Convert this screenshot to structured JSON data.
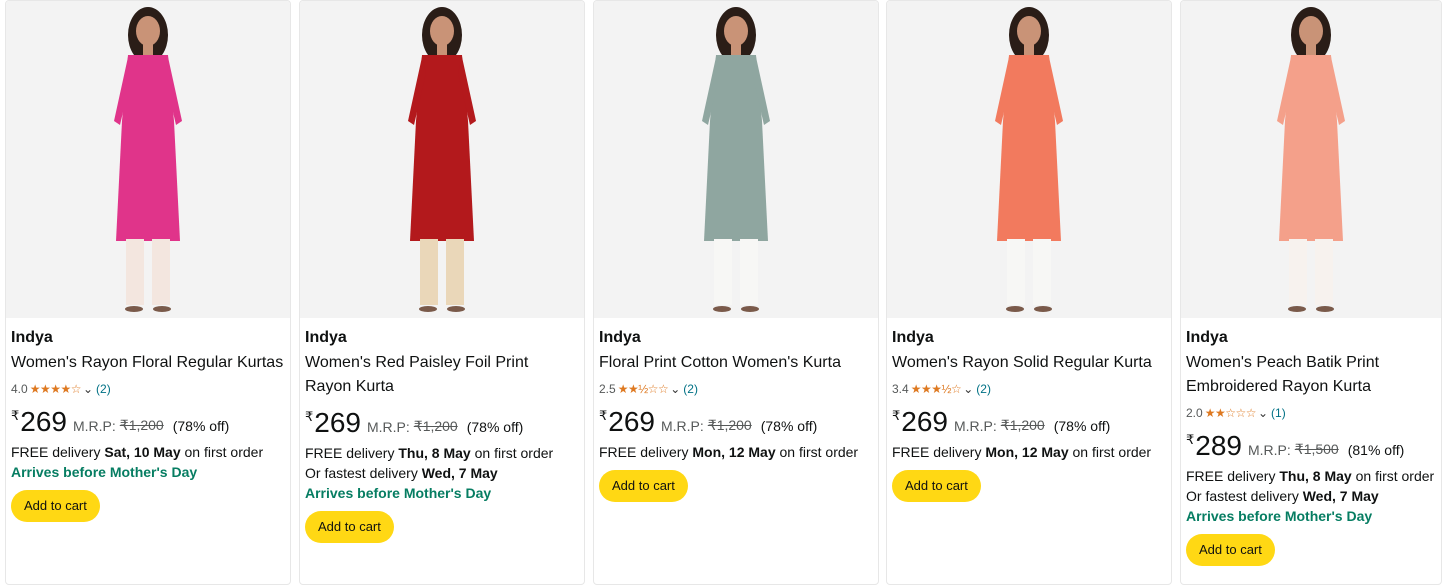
{
  "products": [
    {
      "brand": "Indya",
      "title": "Women's Rayon Floral Regular Kurtas",
      "rating": "4.0",
      "stars": "★★★★☆",
      "review_count": "(2)",
      "currency": "₹",
      "price": "269",
      "mrp_label": "M.R.P:",
      "mrp": "₹1,200",
      "discount": "(78% off)",
      "delivery_prefix": "FREE delivery ",
      "delivery_date": "Sat, 10 May",
      "delivery_suffix": " on first order",
      "fastest_prefix": "",
      "fastest_date": "",
      "arrives": "Arrives before Mother's Day",
      "add_to_cart": "Add to cart",
      "kurta_color": "#e0348a",
      "pants_color": "#f3e6df"
    },
    {
      "brand": "Indya",
      "title": "Women's Red Paisley Foil Print Rayon Kurta",
      "rating": "",
      "stars": "",
      "review_count": "",
      "currency": "₹",
      "price": "269",
      "mrp_label": "M.R.P:",
      "mrp": "₹1,200",
      "discount": "(78% off)",
      "delivery_prefix": "FREE delivery ",
      "delivery_date": "Thu, 8 May",
      "delivery_suffix": " on first order",
      "fastest_prefix": "Or fastest delivery ",
      "fastest_date": "Wed, 7 May",
      "arrives": "Arrives before Mother's Day",
      "add_to_cart": "Add to cart",
      "kurta_color": "#b3191c",
      "pants_color": "#ead7b9"
    },
    {
      "brand": "Indya",
      "title": "Floral Print Cotton Women's Kurta",
      "rating": "2.5",
      "stars": "★★½☆☆",
      "review_count": "(2)",
      "currency": "₹",
      "price": "269",
      "mrp_label": "M.R.P:",
      "mrp": "₹1,200",
      "discount": "(78% off)",
      "delivery_prefix": "FREE delivery ",
      "delivery_date": "Mon, 12 May",
      "delivery_suffix": " on first order",
      "fastest_prefix": "",
      "fastest_date": "",
      "arrives": "",
      "add_to_cart": "Add to cart",
      "kurta_color": "#8fa6a0",
      "pants_color": "#f7f7f5"
    },
    {
      "brand": "Indya",
      "title": "Women's Rayon Solid Regular Kurta",
      "rating": "3.4",
      "stars": "★★★½☆",
      "review_count": "(2)",
      "currency": "₹",
      "price": "269",
      "mrp_label": "M.R.P:",
      "mrp": "₹1,200",
      "discount": "(78% off)",
      "delivery_prefix": "FREE delivery ",
      "delivery_date": "Mon, 12 May",
      "delivery_suffix": " on first order",
      "fastest_prefix": "",
      "fastest_date": "",
      "arrives": "",
      "add_to_cart": "Add to cart",
      "kurta_color": "#f27a5e",
      "pants_color": "#f7f7f5"
    },
    {
      "brand": "Indya",
      "title": "Women's Peach Batik Print Embroidered Rayon Kurta",
      "rating": "2.0",
      "stars": "★★☆☆☆",
      "review_count": "(1)",
      "currency": "₹",
      "price": "289",
      "mrp_label": "M.R.P:",
      "mrp": "₹1,500",
      "discount": "(81% off)",
      "delivery_prefix": "FREE delivery ",
      "delivery_date": "Thu, 8 May",
      "delivery_suffix": " on first order",
      "fastest_prefix": "Or fastest delivery ",
      "fastest_date": "Wed, 7 May",
      "arrives": "Arrives before Mother's Day",
      "add_to_cart": "Add to cart",
      "kurta_color": "#f4a08a",
      "pants_color": "#f7f2ee"
    }
  ],
  "colors": {
    "accent_button": "#ffd814",
    "arrives_text": "#067d62",
    "star": "#de7921",
    "link": "#007185"
  }
}
